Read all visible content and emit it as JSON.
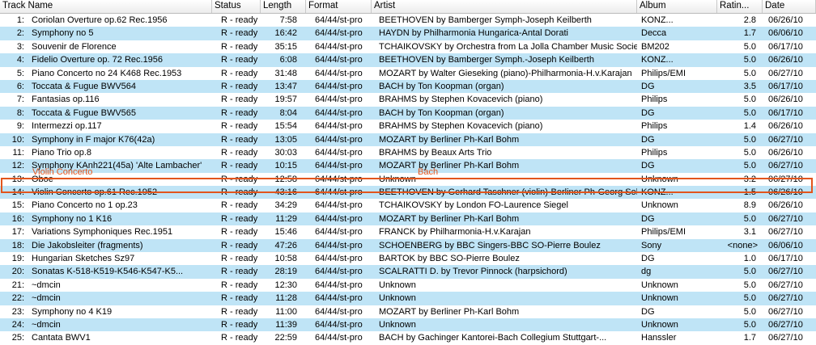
{
  "columns": {
    "track": "Track Name",
    "status": "Status",
    "length": "Length",
    "format": "Format",
    "artist": "Artist",
    "album": "Album",
    "rating": "Ratin...",
    "date": "Date"
  },
  "overlay": {
    "title_label": "Violin Concerto",
    "artist_label": "Bach"
  },
  "accent_color": "#e2551d",
  "alt_row_color": "#bfe4f6",
  "rows": [
    {
      "num": "1:",
      "name": "Coriolan Overture op.62 Rec.1956",
      "status": "R - ready",
      "length": "7:58",
      "format": "64/44/st-pro",
      "artist": "BEETHOVEN by Bamberger Symph-Joseph Keilberth",
      "album": "KONZ...",
      "rating": "2.8",
      "date": "06/26/10"
    },
    {
      "num": "2:",
      "name": "Symphony no 5",
      "status": "R - ready",
      "length": "16:42",
      "format": "64/44/st-pro",
      "artist": "HAYDN by Philharmonia Hungarica-Antal Dorati",
      "album": "Decca",
      "rating": "1.7",
      "date": "06/06/10"
    },
    {
      "num": "3:",
      "name": "Souvenir de Florence",
      "status": "R - ready",
      "length": "35:15",
      "format": "64/44/st-pro",
      "artist": "TCHAIKOVSKY by Orchestra from La Jolla Chamber Music Society",
      "album": "BM202",
      "rating": "5.0",
      "date": "06/17/10"
    },
    {
      "num": "4:",
      "name": "Fidelio Overture op. 72 Rec.1956",
      "status": "R - ready",
      "length": "6:08",
      "format": "64/44/st-pro",
      "artist": "BEETHOVEN by Bamberger Symph.-Joseph Keilberth",
      "album": "KONZ...",
      "rating": "5.0",
      "date": "06/26/10"
    },
    {
      "num": "5:",
      "name": "Piano Concerto no 24 K468  Rec.1953",
      "status": "R - ready",
      "length": "31:48",
      "format": "64/44/st-pro",
      "artist": "MOZART by Walter Gieseking (piano)-Philharmonia-H.v.Karajan",
      "album": "Philips/EMI",
      "rating": "5.0",
      "date": "06/27/10"
    },
    {
      "num": "6:",
      "name": "Toccata & Fugue BWV564",
      "status": "R - ready",
      "length": "13:47",
      "format": "64/44/st-pro",
      "artist": "BACH by Ton Koopman (organ)",
      "album": "DG",
      "rating": "3.5",
      "date": "06/17/10"
    },
    {
      "num": "7:",
      "name": "Fantasias op.116",
      "status": "R - ready",
      "length": "19:57",
      "format": "64/44/st-pro",
      "artist": "BRAHMS by Stephen Kovacevich (piano)",
      "album": "Philips",
      "rating": "5.0",
      "date": "06/26/10"
    },
    {
      "num": "8:",
      "name": "Toccata & Fugue BWV565",
      "status": "R - ready",
      "length": "8:04",
      "format": "64/44/st-pro",
      "artist": "BACH by Ton Koopman (organ)",
      "album": "DG",
      "rating": "5.0",
      "date": "06/17/10"
    },
    {
      "num": "9:",
      "name": "Intermezzi op.117",
      "status": "R - ready",
      "length": "15:54",
      "format": "64/44/st-pro",
      "artist": "BRAHMS by Stephen Kovacevich (piano)",
      "album": "Philips",
      "rating": "1.4",
      "date": "06/26/10"
    },
    {
      "num": "10:",
      "name": "Symphony in F major K76(42a)",
      "status": "R - ready",
      "length": "13:05",
      "format": "64/44/st-pro",
      "artist": "MOZART by Berliner Ph-Karl Bohm",
      "album": "DG",
      "rating": "5.0",
      "date": "06/27/10"
    },
    {
      "num": "11:",
      "name": "Piano Trio op.8",
      "status": "R - ready",
      "length": "30:03",
      "format": "64/44/st-pro",
      "artist": "BRAHMS by Beaux Arts Trio",
      "album": "Philips",
      "rating": "5.0",
      "date": "06/26/10"
    },
    {
      "num": "12:",
      "name": "Symphony KAnh221(45a) 'Alte Lambacher'",
      "status": "R - ready",
      "length": "10:15",
      "format": "64/44/st-pro",
      "artist": "MOZART by Berliner Ph-Karl Bohm",
      "album": "DG",
      "rating": "5.0",
      "date": "06/27/10"
    },
    {
      "num": "13:",
      "name": "Oboe",
      "status": "R - ready",
      "length": "12:58",
      "format": "64/44/st-pro",
      "artist": "Unknown",
      "album": "Unknown",
      "rating": "3.2",
      "date": "06/27/10"
    },
    {
      "num": "14:",
      "name": "Violin Concerto op.61 Rec.1952",
      "status": "R - ready",
      "length": "43:16",
      "format": "64/44/st-pro",
      "artist": "BEETHOVEN by Gerhard Taschner (violin)-Berliner Ph-Georg Solti",
      "album": "KONZ...",
      "rating": "1.5",
      "date": "06/26/10"
    },
    {
      "num": "15:",
      "name": "Piano Concerto no 1 op.23",
      "status": "R - ready",
      "length": "34:29",
      "format": "64/44/st-pro",
      "artist": "TCHAIKOVSKY by London FO-Laurence Siegel",
      "album": "Unknown",
      "rating": "8.9",
      "date": "06/26/10"
    },
    {
      "num": "16:",
      "name": "Symphony no 1 K16",
      "status": "R - ready",
      "length": "11:29",
      "format": "64/44/st-pro",
      "artist": "MOZART by Berliner Ph-Karl Bohm",
      "album": "DG",
      "rating": "5.0",
      "date": "06/27/10"
    },
    {
      "num": "17:",
      "name": "Variations Symphoniques Rec.1951",
      "status": "R - ready",
      "length": "15:46",
      "format": "64/44/st-pro",
      "artist": "FRANCK by Philharmonia-H.v.Karajan",
      "album": "Philips/EMI",
      "rating": "3.1",
      "date": "06/27/10"
    },
    {
      "num": "18:",
      "name": "Die Jakobsleiter (fragments)",
      "status": "R - ready",
      "length": "47:26",
      "format": "64/44/st-pro",
      "artist": "SCHOENBERG by BBC Singers-BBC SO-Pierre Boulez",
      "album": "Sony",
      "rating": "<none>",
      "date": "06/06/10"
    },
    {
      "num": "19:",
      "name": "Hungarian Sketches Sz97",
      "status": "R - ready",
      "length": "10:58",
      "format": "64/44/st-pro",
      "artist": "BARTOK by BBC SO-Pierre Boulez",
      "album": "DG",
      "rating": "1.0",
      "date": "06/17/10"
    },
    {
      "num": "20:",
      "name": "Sonatas K-518-K519-K546-K547-K5...",
      "status": "R - ready",
      "length": "28:19",
      "format": "64/44/st-pro",
      "artist": "SCALRATTI D. by Trevor Pinnock (harpsichord)",
      "album": "dg",
      "rating": "5.0",
      "date": "06/27/10"
    },
    {
      "num": "21:",
      "name": "~dmcin",
      "status": "R - ready",
      "length": "12:30",
      "format": "64/44/st-pro",
      "artist": "Unknown",
      "album": "Unknown",
      "rating": "5.0",
      "date": "06/27/10"
    },
    {
      "num": "22:",
      "name": "~dmcin",
      "status": "R - ready",
      "length": "11:28",
      "format": "64/44/st-pro",
      "artist": "Unknown",
      "album": "Unknown",
      "rating": "5.0",
      "date": "06/27/10"
    },
    {
      "num": "23:",
      "name": "Symphony no 4 K19",
      "status": "R - ready",
      "length": "11:00",
      "format": "64/44/st-pro",
      "artist": "MOZART by Berliner Ph-Karl Bohm",
      "album": "DG",
      "rating": "5.0",
      "date": "06/27/10"
    },
    {
      "num": "24:",
      "name": "~dmcin",
      "status": "R - ready",
      "length": "11:39",
      "format": "64/44/st-pro",
      "artist": "Unknown",
      "album": "Unknown",
      "rating": "5.0",
      "date": "06/27/10"
    },
    {
      "num": "25:",
      "name": "Cantata BWV1",
      "status": "R - ready",
      "length": "22:59",
      "format": "64/44/st-pro",
      "artist": "BACH by Gachinger Kantorei-Bach Collegium Stuttgart-...",
      "album": "Hanssler",
      "rating": "1.7",
      "date": "06/27/10"
    }
  ]
}
